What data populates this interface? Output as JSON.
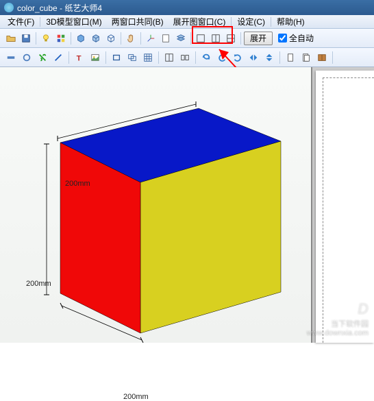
{
  "title": "color_cube - 纸艺大师4",
  "menubar": {
    "file": "文件(F)",
    "model3d": "3D模型窗口(M)",
    "both": "两窗口共同(B)",
    "unfold": "展开图窗口(C)",
    "settings": "设定(C)",
    "help": "帮助(H)"
  },
  "toolbar": {
    "expand_label": "展开",
    "auto_label": "全自动"
  },
  "dimensions": {
    "width": "200mm",
    "height": "200mm",
    "depth": "200mm"
  },
  "watermark": {
    "brand": "当下软件园",
    "url": "www.downxia.com"
  },
  "icons": {
    "open": "open-icon",
    "save": "save-icon",
    "lightbulb": "lightbulb-icon",
    "cube1": "cube-icon",
    "cube2": "cube-wire-icon",
    "hand": "hand-icon",
    "axis": "axis-icon",
    "layers": "layers-icon",
    "splitv": "split-v-icon",
    "splith": "split-h-icon"
  }
}
